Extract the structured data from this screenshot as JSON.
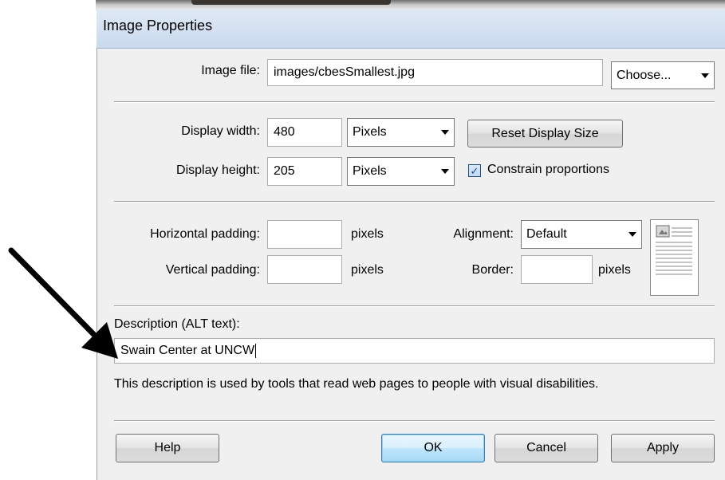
{
  "dialog": {
    "title": "Image Properties"
  },
  "image_file": {
    "label": "Image file:",
    "value": "images/cbesSmallest.jpg",
    "choose_button": "Choose..."
  },
  "display": {
    "width_label": "Display width:",
    "width_value": "480",
    "width_unit": "Pixels",
    "height_label": "Display height:",
    "height_value": "205",
    "height_unit": "Pixels",
    "reset_button": "Reset Display Size",
    "constrain_label": "Constrain proportions",
    "constrain_checked": true
  },
  "padding": {
    "horizontal_label": "Horizontal padding:",
    "horizontal_value": "",
    "horizontal_unit": "pixels",
    "vertical_label": "Vertical padding:",
    "vertical_value": "",
    "vertical_unit": "pixels"
  },
  "alignment": {
    "label": "Alignment:",
    "value": "Default"
  },
  "border": {
    "label": "Border:",
    "value": "",
    "unit": "pixels"
  },
  "description": {
    "label": "Description (ALT text):",
    "value": "Swain Center at UNCW",
    "help_text": "This description is used by tools that read web pages to people with visual disabilities."
  },
  "buttons": {
    "help": "Help",
    "ok": "OK",
    "cancel": "Cancel",
    "apply": "Apply"
  },
  "colors": {
    "titlebar": "#c9daee",
    "dialog_bg": "#f0f0f0",
    "arrow": "#000000"
  }
}
